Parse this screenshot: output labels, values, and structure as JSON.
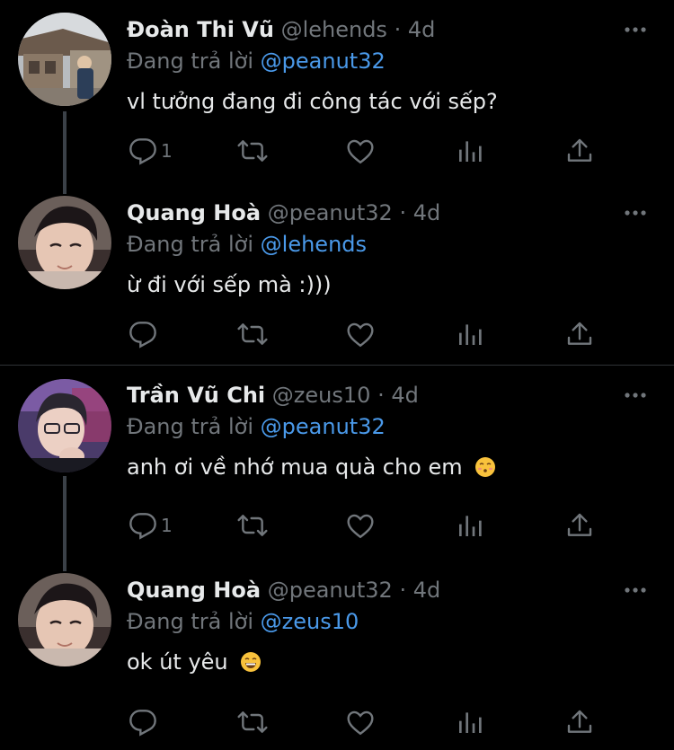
{
  "tweets": [
    {
      "name": "Đoàn Thi Vũ",
      "handle": "@lehends",
      "separator": "·",
      "time": "4d",
      "replying_prefix": "Đang trả lời",
      "replying_to": "@peanut32",
      "text": "vl tưởng đang đi công tác với sếp?",
      "reply_count": "1"
    },
    {
      "name": "Quang Hoà",
      "handle": "@peanut32",
      "separator": "·",
      "time": "4d",
      "replying_prefix": "Đang trả lời",
      "replying_to": "@lehends",
      "text": "ừ đi với sếp mà :)))",
      "reply_count": ""
    },
    {
      "name": "Trần Vũ Chi",
      "handle": "@zeus10",
      "separator": "·",
      "time": "4d",
      "replying_prefix": "Đang trả lời",
      "replying_to": "@peanut32",
      "text": "anh ơi về nhớ mua quà cho em",
      "reply_count": "1"
    },
    {
      "name": "Quang Hoà",
      "handle": "@peanut32",
      "separator": "·",
      "time": "4d",
      "replying_prefix": "Đang trả lời",
      "replying_to": "@zeus10",
      "text": "ok út yêu",
      "reply_count": ""
    }
  ],
  "icons": {
    "more": "more-icon",
    "reply": "reply-icon",
    "retweet": "retweet-icon",
    "like": "heart-icon",
    "analytics": "analytics-icon",
    "share": "share-icon"
  },
  "colors": {
    "background": "#000000",
    "text": "#e7e9ea",
    "secondary": "#71767b",
    "accent": "#4a99e9",
    "thread_line": "#3b4148",
    "divider": "#2f3336"
  }
}
